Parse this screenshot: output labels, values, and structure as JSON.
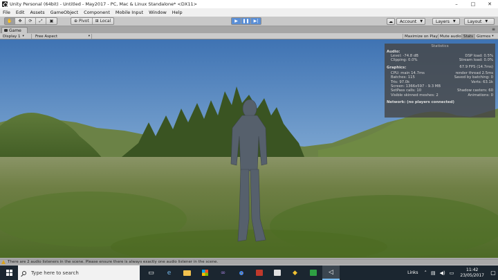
{
  "window": {
    "title": "Unity Personal (64bit) - Untitled - May2017 - PC, Mac & Linux Standalone* <DX11>",
    "controls": [
      "–",
      "□",
      "✕"
    ]
  },
  "menu": [
    "File",
    "Edit",
    "Assets",
    "GameObject",
    "Component",
    "Mobile Input",
    "Window",
    "Help"
  ],
  "toolbar": {
    "tools": [
      "hand",
      "move",
      "rotate",
      "scale",
      "rect"
    ],
    "pivot_label": "Pivot",
    "local_label": "Local",
    "play_buttons": [
      "play",
      "pause",
      "step"
    ],
    "account_label": "Account",
    "layers_label": "Layers",
    "layout_label": "Layout"
  },
  "game_tab": {
    "label": "Game",
    "display": "Display 1",
    "aspect": "Free Aspect",
    "maximize_on_play": "Maximize on Play",
    "mute_audio": "Mute audio",
    "stats": "Stats",
    "gizmos": "Gizmos"
  },
  "stats": {
    "title": "Statistics",
    "audio_header": "Audio:",
    "audio": [
      [
        "Level: -74.8 dB",
        "DSP load: 0.5%"
      ],
      [
        "Clipping: 0.0%",
        "Stream load: 0.0%"
      ]
    ],
    "graphics_header": "Graphics:",
    "fps": "67.9 FPS (14.7ms)",
    "graphics": [
      [
        "CPU: main 14.7ms",
        "render thread 2.5ms"
      ],
      [
        "Batches: 115",
        "Saved by batching: 0"
      ],
      [
        "Tris: 97.0k",
        "Verts: 63.1k"
      ],
      [
        "Screen: 1366x597 - 9.3 MB",
        ""
      ],
      [
        "SetPass calls: 10",
        "Shadow casters: 60"
      ],
      [
        "Visible skinned meshes: 2",
        "Animations: 0"
      ]
    ],
    "network": "Network: (no players connected)"
  },
  "console": {
    "message": "There are 2 audio listeners in the scene. Please ensure there is always exactly one audio listener in the scene."
  },
  "taskbar": {
    "search_placeholder": "Type here to search",
    "links_label": "Links",
    "time": "11:42",
    "date": "23/05/2017"
  }
}
